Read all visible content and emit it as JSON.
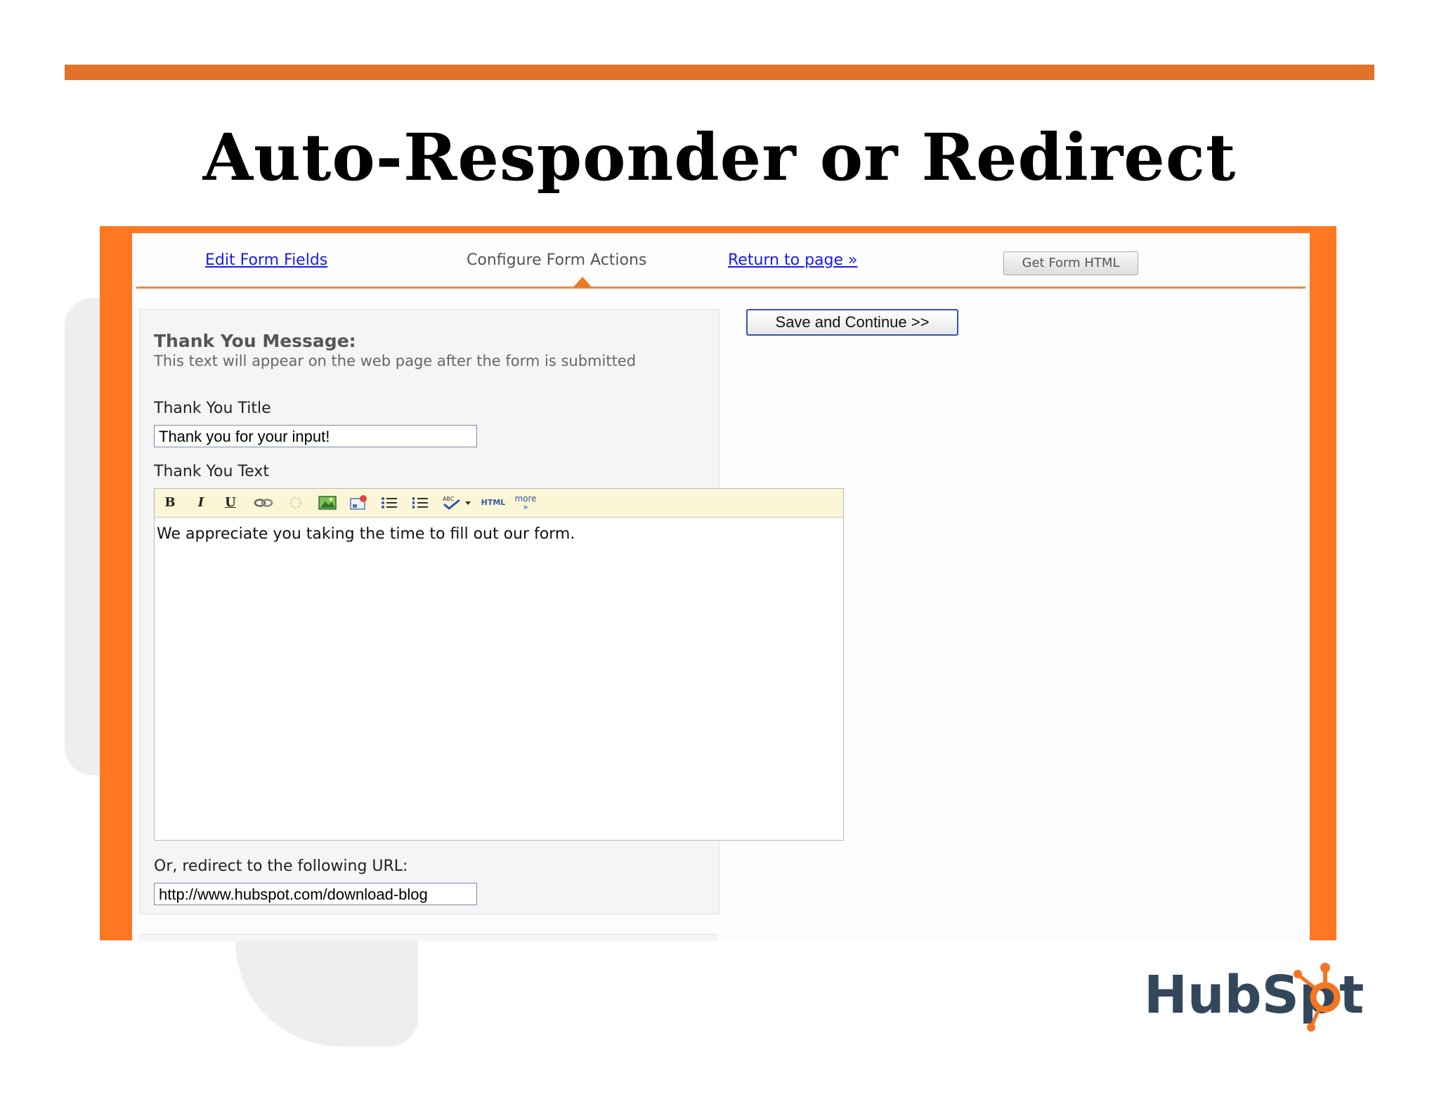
{
  "slide": {
    "title": "Auto-Responder or Redirect"
  },
  "tabs": {
    "edit_fields": "Edit Form Fields",
    "configure_actions": "Configure Form Actions",
    "return_to_page": "Return to page »",
    "get_form_html": "Get Form HTML"
  },
  "actions": {
    "save_continue": "Save and Continue >>"
  },
  "thank_you": {
    "heading": "Thank You Message:",
    "description": "This text will appear on the web page after the form is submitted",
    "title_label": "Thank You Title",
    "title_value": "Thank you for your input!",
    "text_label": "Thank You Text",
    "text_value": "We appreciate you taking the time to fill out our form."
  },
  "editor_toolbar": {
    "bold": "B",
    "italic": "I",
    "underline": "U",
    "html": "HTML",
    "more": "more »"
  },
  "redirect": {
    "label": "Or, redirect to the following URL:",
    "url_value": "http://www.hubspot.com/download-blog"
  },
  "logo": {
    "text": "HubSpot",
    "color_text": "#33475b",
    "color_accent": "#f47622"
  },
  "colors": {
    "accent_orange": "#ff7722",
    "rule_orange": "#e2712a",
    "link_blue": "#1a1aee"
  }
}
